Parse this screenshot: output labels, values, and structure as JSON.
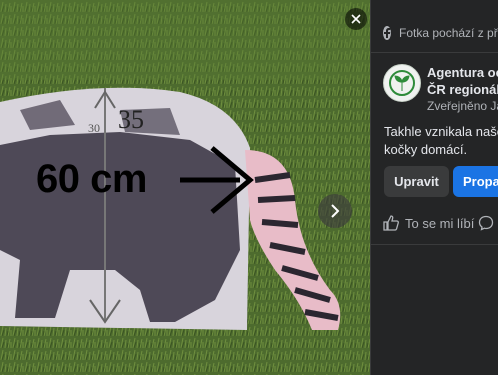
{
  "photo": {
    "overlay_label": "60 cm",
    "drawn_numbers": [
      "35",
      "30"
    ]
  },
  "panel": {
    "info_text": "Fotka pochází z pří",
    "author_name_line1": "Agentura oc",
    "author_name_line2": "ČR regionáln",
    "date": "Zveřejněno Ja",
    "post_line1": "Takhle vznikala naše",
    "post_line2": "kočky domácí.",
    "edit_label": "Upravit",
    "promote_label": "Propa",
    "like_label": "To se mi líbí"
  },
  "colors": {
    "accent": "#1b74e4",
    "panel_bg": "#242526",
    "logo_green": "#2e8b3a"
  }
}
